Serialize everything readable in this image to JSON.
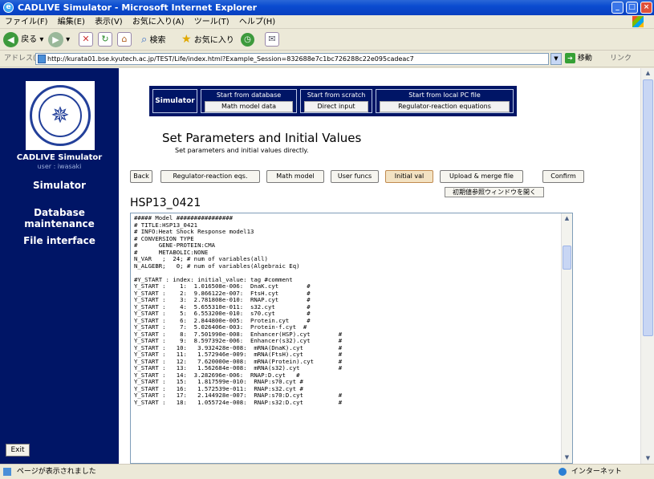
{
  "window": {
    "title": "CADLIVE Simulator - Microsoft Internet Explorer"
  },
  "menu": [
    "ファイル(F)",
    "編集(E)",
    "表示(V)",
    "お気に入り(A)",
    "ツール(T)",
    "ヘルプ(H)"
  ],
  "toolbar": {
    "back": "戻る",
    "search": "検索",
    "favorites": "お気に入り"
  },
  "address": {
    "label": "アドレス(D)",
    "url": "http://kurata01.bse.kyutech.ac.jp/TEST/Life/index.html?Example_Session=832688e7c1bc726288c22e095cadeac7",
    "go": "移動",
    "links": "リンク"
  },
  "sidebar": {
    "app_name": "CADLIVE Simulator",
    "user": "user : iwasaki",
    "nav": [
      "Simulator",
      "Database maintenance",
      "File interface"
    ],
    "exit": "Exit"
  },
  "topnav": {
    "simulator": "Simulator",
    "groups": [
      {
        "label": "Start from database",
        "button": "Math model data"
      },
      {
        "label": "Start from scratch",
        "button": "Direct input"
      },
      {
        "label": "Start from local PC file",
        "button": "Regulator-reaction equations"
      }
    ]
  },
  "heading": "Set Parameters and Initial Values",
  "subheading": "Set parameters and initial values directly.",
  "buttons": [
    "Back",
    "Regulator-reaction eqs.",
    "Math model",
    "User funcs",
    "Initial val",
    "Upload & merge file",
    "Confirm"
  ],
  "ref_button": "初期値参照ウィンドウを開く",
  "model_title": "HSP13_0421",
  "code_lines": [
    "##### Model ################",
    "# TITLE:HSP13_0421",
    "# INFO:Heat Shock Response model13",
    "# CONVERSION TYPE",
    "#      GENE-PROTEIN:CMA",
    "#      METABOLIC:NONE",
    "N_VAR   ;  24; # num of variables(all)",
    "N_ALGEBR;   0; # num of variables(Algebraic Eq)",
    "",
    "#Y_START : index: initial_value: tag #comment",
    "Y_START :    1:  1.016508e-006:  DnaK.cyt        #",
    "Y_START :    2:  9.866122e-007:  FtsH.cyt        #",
    "Y_START :    3:  2.781808e-010:  RNAP.cyt        #",
    "Y_START :    4:  5.655310e-011:  s32.cyt         #",
    "Y_START :    5:  6.553200e-010:  s70.cyt         #",
    "Y_START :    6:  2.844800e-005:  Protein.cyt     #",
    "Y_START :    7:  5.026406e-003:  Protein-f.cyt  #",
    "Y_START :    8:  7.501990e-008:  Enhancer(HSP).cyt        #",
    "Y_START :    9:  8.597392e-006:  Enhancer(s32).cyt        #",
    "Y_START :   10:   3.932428e-008:  mRNA(DnaK).cyt          #",
    "Y_START :   11:   1.572946e-009:  mRNA(FtsH).cyt          #",
    "Y_START :   12:   7.620000e-008:  mRNA(Protein).cyt       #",
    "Y_START :   13:   1.562684e-008:  mRNA(s32).cyt           #",
    "Y_START :   14:  3.282696e-006:  RNAP:D.cyt   #",
    "Y_START :   15:   1.817599e-010:  RNAP:s70.cyt #",
    "Y_START :   16:   1.572539e-011:  RNAP:s32.cyt #",
    "Y_START :   17:   2.144928e-007:  RNAP:s70:D.cyt          #",
    "Y_START :   18:   1.055724e-008:  RNAP:s32:D.cyt          #"
  ],
  "status": {
    "text": "ページが表示されました",
    "zone": "インターネット"
  }
}
